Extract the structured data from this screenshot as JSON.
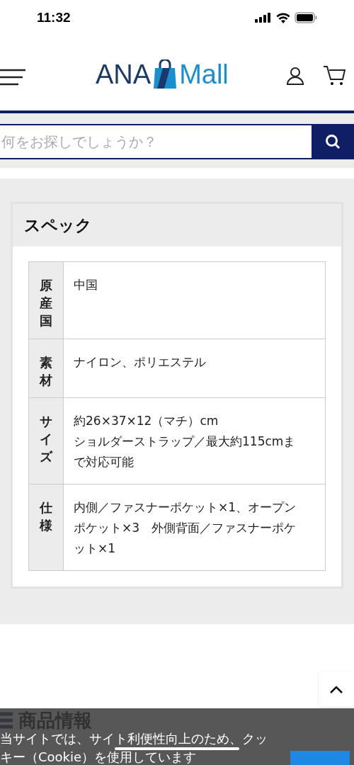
{
  "status_bar": {
    "time": "11:32"
  },
  "header": {
    "logo_left": "ANA",
    "logo_right": "Mall"
  },
  "search": {
    "placeholder": "何をお探しでしょうか？"
  },
  "spec": {
    "title": "スペック",
    "rows": [
      {
        "label": "原産国",
        "value": "中国"
      },
      {
        "label": "素材",
        "value": "ナイロン、ポリエステル"
      },
      {
        "label": "サイズ",
        "value": "約26×37×12（マチ）cm\nショルダーストラップ／最大約115cmまで対応可能"
      },
      {
        "label": "仕様",
        "value": "内側／ファスナーポケット×1、オープンポケット×3　外側背面／ファスナーポケット×1"
      }
    ]
  },
  "product_info": {
    "title": "商品情報"
  },
  "cookie_banner": {
    "lines": [
      "当サイトでは、サイト利便性向上のため、クッ",
      "キー（Cookie）を使用しています"
    ]
  }
}
